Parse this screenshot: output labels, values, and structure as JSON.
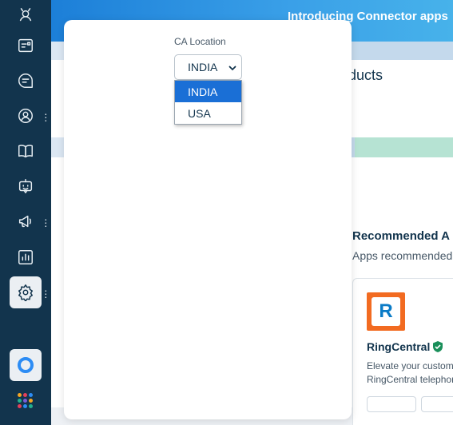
{
  "sidebar": {
    "items": [
      {
        "name": "freshworks-logo-icon"
      },
      {
        "name": "tickets-icon"
      },
      {
        "name": "chat-icon"
      },
      {
        "name": "contacts-icon"
      },
      {
        "name": "knowledge-base-icon"
      },
      {
        "name": "bot-icon"
      },
      {
        "name": "announcements-icon"
      },
      {
        "name": "reports-icon"
      },
      {
        "name": "settings-icon",
        "active": true
      }
    ],
    "apps_grid_colors": [
      "#f5a623",
      "#e3405a",
      "#2c8cf4",
      "#23b08d",
      "#7b5bd6",
      "#f5a623",
      "#e3405a",
      "#2c8cf4",
      "#23b08d"
    ],
    "accent_color": "#2c8cf4"
  },
  "banner": {
    "text": "Introducing Connector apps"
  },
  "hero": {
    "title": "oducts"
  },
  "recommended": {
    "title": "Recommended A",
    "subtitle": "Apps recommended",
    "card": {
      "name": "RingCentral",
      "logo_letter": "R",
      "desc_line1": "Elevate your custome",
      "desc_line2": "RingCentral telephor"
    }
  },
  "modal": {
    "field_label": "CA Location",
    "select_value": "INDIA",
    "options": [
      "INDIA",
      "USA"
    ],
    "selected_option": "INDIA"
  }
}
